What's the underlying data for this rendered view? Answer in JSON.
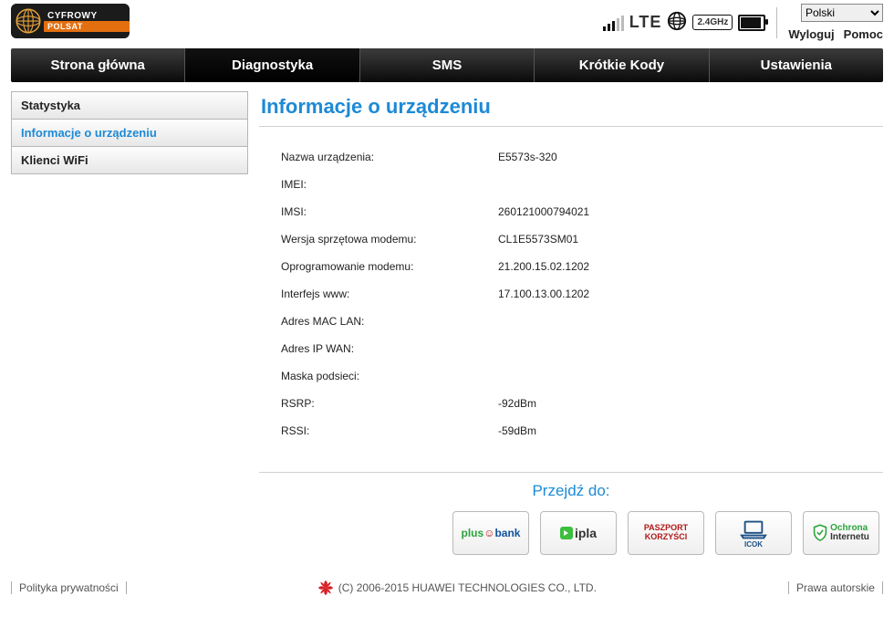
{
  "brand": {
    "line1": "CYFROWY",
    "line2": "POLSAT"
  },
  "status": {
    "network": "LTE",
    "wifi_band": "2.4GHz"
  },
  "language": {
    "selected": "Polski"
  },
  "header_links": {
    "logout": "Wyloguj",
    "help": "Pomoc"
  },
  "nav": {
    "home": "Strona główna",
    "diag": "Diagnostyka",
    "sms": "SMS",
    "codes": "Krótkie Kody",
    "settings": "Ustawienia"
  },
  "sidebar": {
    "stats": "Statystyka",
    "device": "Informacje o urządzeniu",
    "wifi": "Klienci WiFi"
  },
  "page_title": "Informacje o urządzeniu",
  "info": [
    {
      "k": "Nazwa urządzenia:",
      "v": "E5573s-320"
    },
    {
      "k": "IMEI:",
      "v": ""
    },
    {
      "k": "IMSI:",
      "v": "260121000794021"
    },
    {
      "k": "Wersja sprzętowa modemu:",
      "v": "CL1E5573SM01"
    },
    {
      "k": "Oprogramowanie modemu:",
      "v": "21.200.15.02.1202"
    },
    {
      "k": "Interfejs www:",
      "v": "17.100.13.00.1202"
    },
    {
      "k": "Adres MAC LAN:",
      "v": ""
    },
    {
      "k": "Adres IP WAN:",
      "v": ""
    },
    {
      "k": "Maska podsieci:",
      "v": ""
    },
    {
      "k": "RSRP:",
      "v": "-92dBm"
    },
    {
      "k": "RSSI:",
      "v": "-59dBm"
    }
  ],
  "goto": {
    "title": "Przejdź do:",
    "btn_paszport_l1": "PASZPORT",
    "btn_paszport_l2": "KORZYŚCI",
    "btn_icok": "ICOK"
  },
  "footer": {
    "privacy": "Polityka prywatności",
    "copyright": "(C) 2006-2015 HUAWEI TECHNOLOGIES CO., LTD.",
    "legal": "Prawa autorskie"
  }
}
